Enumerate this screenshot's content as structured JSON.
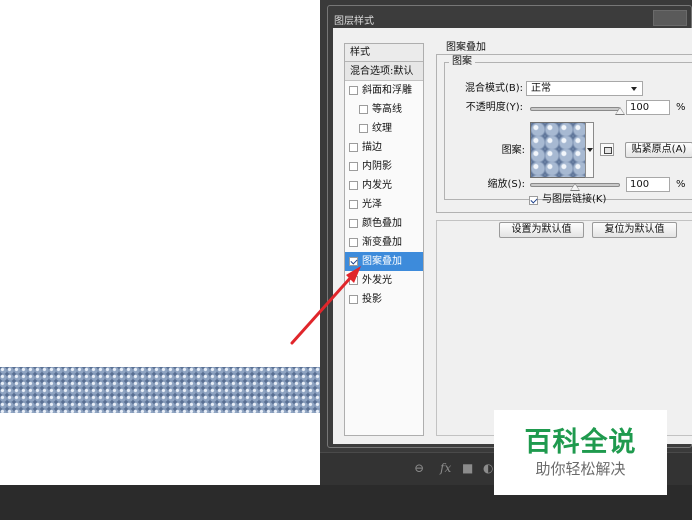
{
  "dialog": {
    "title": "图层样式"
  },
  "style_panel": {
    "header": "样式",
    "blending_options": "混合选项:默认",
    "items": [
      {
        "label": "斜面和浮雕",
        "checked": false,
        "indent": false,
        "selected": false
      },
      {
        "label": "等高线",
        "checked": false,
        "indent": true,
        "selected": false
      },
      {
        "label": "纹理",
        "checked": false,
        "indent": true,
        "selected": false
      },
      {
        "label": "描边",
        "checked": false,
        "indent": false,
        "selected": false
      },
      {
        "label": "内阴影",
        "checked": false,
        "indent": false,
        "selected": false
      },
      {
        "label": "内发光",
        "checked": false,
        "indent": false,
        "selected": false
      },
      {
        "label": "光泽",
        "checked": false,
        "indent": false,
        "selected": false
      },
      {
        "label": "颜色叠加",
        "checked": false,
        "indent": false,
        "selected": false
      },
      {
        "label": "渐变叠加",
        "checked": false,
        "indent": false,
        "selected": false
      },
      {
        "label": "图案叠加",
        "checked": true,
        "indent": false,
        "selected": true
      },
      {
        "label": "外发光",
        "checked": false,
        "indent": false,
        "selected": false
      },
      {
        "label": "投影",
        "checked": false,
        "indent": false,
        "selected": false
      }
    ]
  },
  "pattern_overlay": {
    "group_title": "图案叠加",
    "subgroup_title": "图案",
    "blend_mode_label": "混合模式(B):",
    "blend_mode_value": "正常",
    "opacity_label": "不透明度(Y):",
    "opacity_value": "100",
    "opacity_unit": "%",
    "opacity_fraction": 1.0,
    "pattern_label": "图案:",
    "snap_origin_button": "贴紧原点(A)",
    "scale_label": "缩放(S):",
    "scale_value": "100",
    "scale_unit": "%",
    "scale_fraction": 0.5,
    "link_label": "与图层链接(K)",
    "link_checked": true,
    "make_default_button": "设置为默认值",
    "reset_default_button": "复位为默认值"
  },
  "bottom_bar": {
    "link_icon": "link-icon",
    "fx_label": "fx",
    "mask_icon": "mask-icon",
    "adjust_icon": "adjustment-icon"
  },
  "watermark": {
    "title": "百科全说",
    "subtitle": "助你轻松解决"
  },
  "colors": {
    "accent_selected": "#3d8bdb",
    "arrow": "#e0262b",
    "watermark_green": "#1f9a4e"
  }
}
